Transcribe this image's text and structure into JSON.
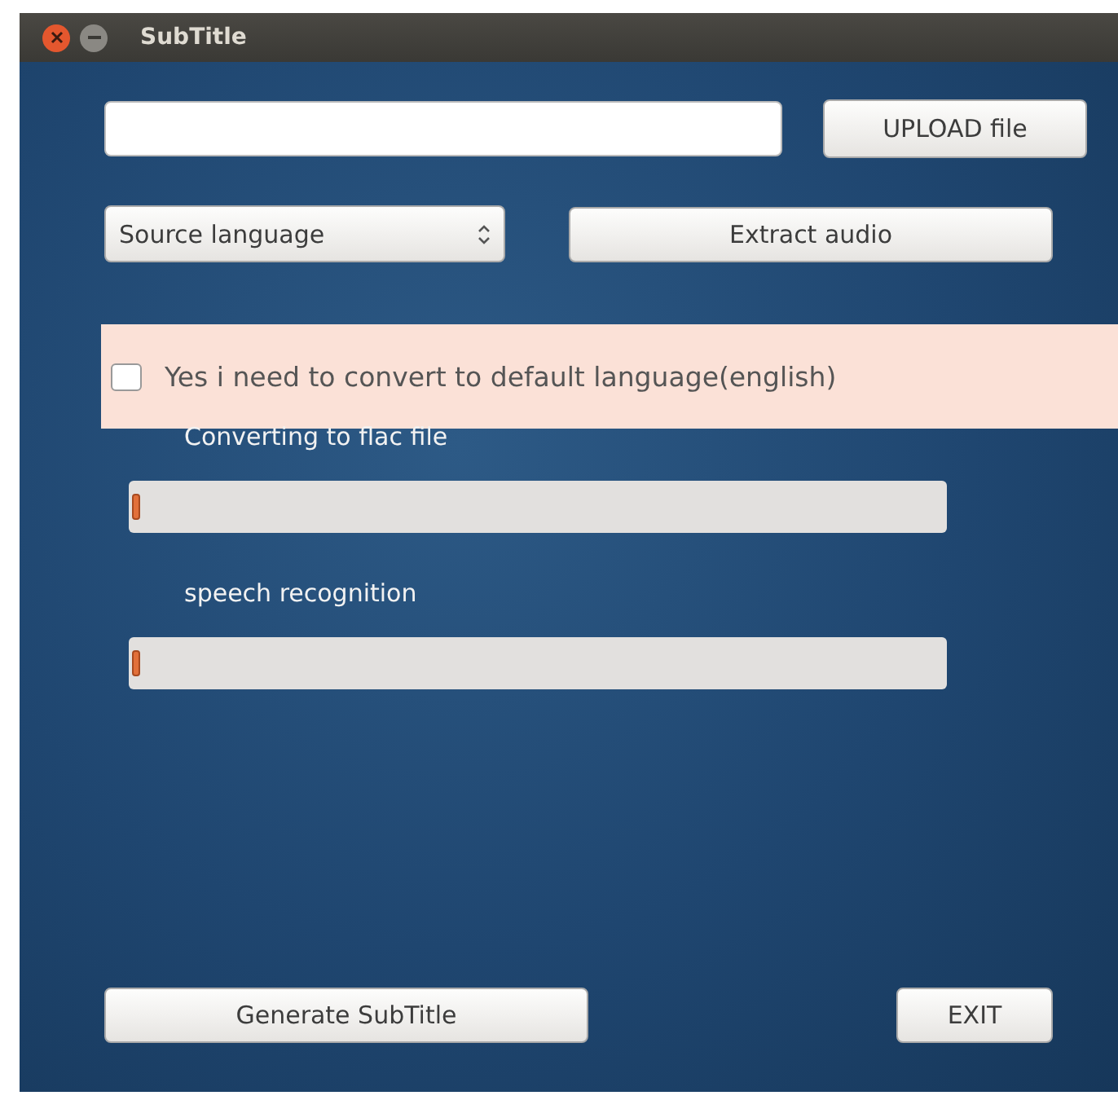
{
  "window": {
    "title": "SubTitle"
  },
  "upload_button": "UPLOAD file",
  "language_select": {
    "value": "Source language"
  },
  "extract_button": "Extract audio",
  "convert_option": {
    "label": "Yes i need to convert to default language(english)",
    "checked": false
  },
  "progress": [
    {
      "label": "Converting to flac file",
      "level": 0.01
    },
    {
      "label": "speech recognition",
      "level": 0.01
    }
  ],
  "generate_button": "Generate SubTitle",
  "exit_button": "EXIT"
}
